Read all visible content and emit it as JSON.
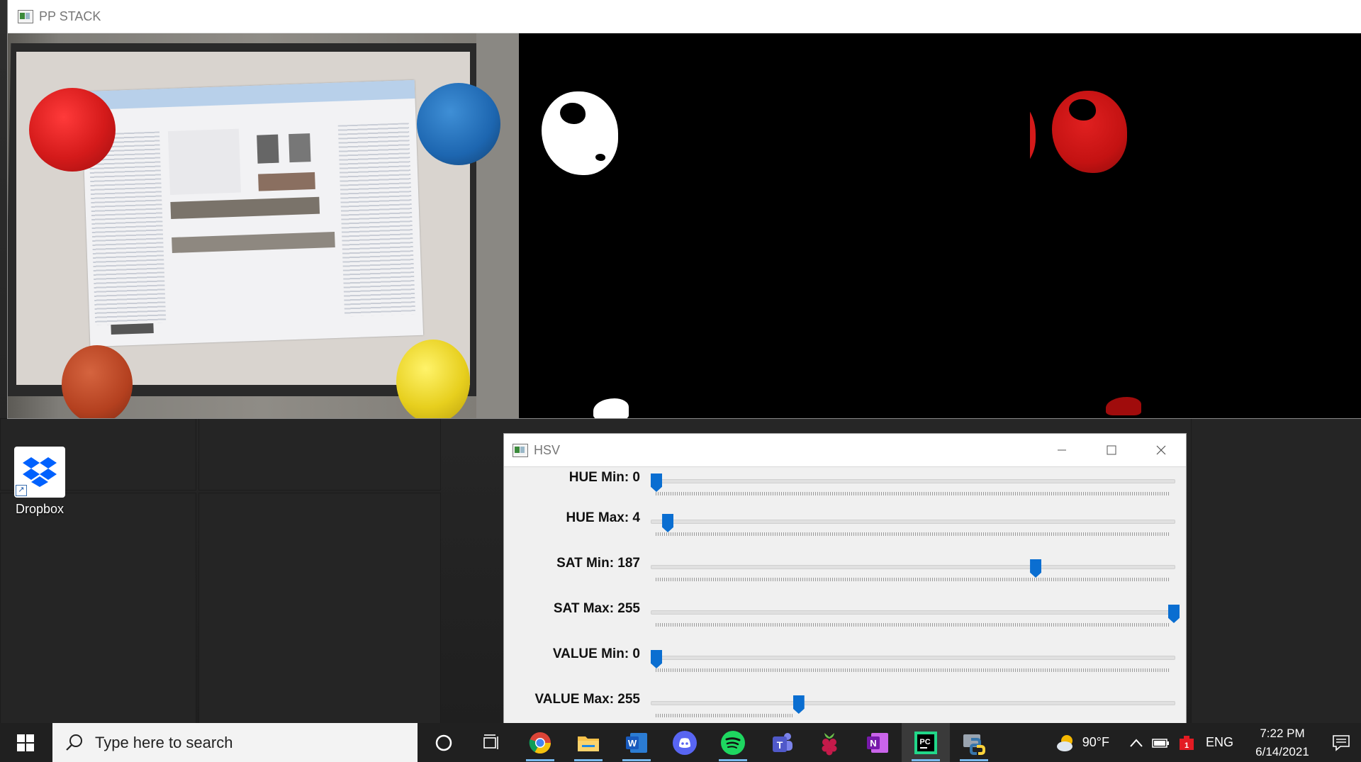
{
  "pp_window": {
    "title": "PP STACK"
  },
  "desktop": {
    "icons": [
      {
        "label": "Dropbox"
      }
    ]
  },
  "hsv_window": {
    "title": "HSV",
    "sliders": [
      {
        "label": "HUE Min: 0",
        "fraction": 0.0
      },
      {
        "label": "HUE Max: 4",
        "fraction": 0.022
      },
      {
        "label": "SAT Min: 187",
        "fraction": 0.733
      },
      {
        "label": "SAT Max: 255",
        "fraction": 1.0
      },
      {
        "label": "VALUE Min: 0",
        "fraction": 0.0
      },
      {
        "label": "VALUE Max: 255",
        "fraction": 0.275
      }
    ]
  },
  "taskbar": {
    "search_placeholder": "Type here to search",
    "pinned": [
      "cortana-icon",
      "task-view-icon",
      "chrome-icon",
      "file-explorer-icon",
      "word-icon",
      "discord-icon",
      "spotify-icon",
      "teams-icon",
      "raspberry-pi-icon",
      "onenote-icon",
      "pycharm-icon",
      "python-icon"
    ],
    "weather": "90°F",
    "language": "ENG",
    "time": "7:22 PM",
    "date": "6/14/2021"
  },
  "colors": {
    "accent": "#0a6ed1",
    "taskbar": "#202020",
    "balloon_red": "#d41a1a"
  }
}
